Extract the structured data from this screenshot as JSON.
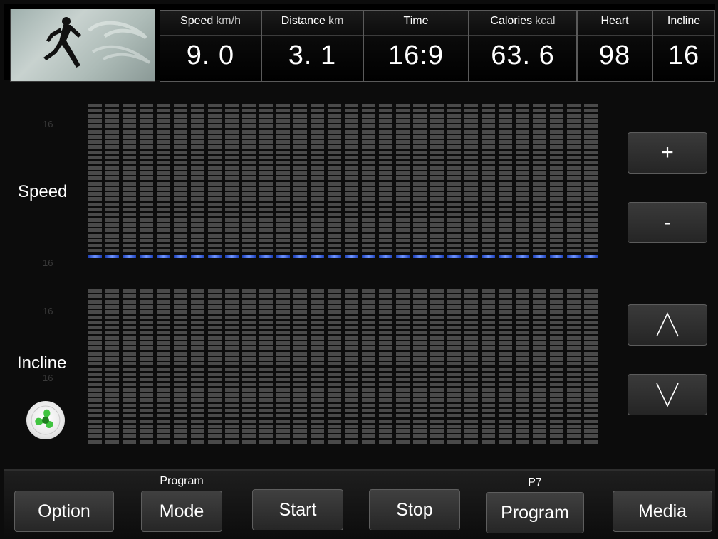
{
  "header": {
    "stats": [
      {
        "label": "Speed",
        "unit": "km/h",
        "value": "9. 0"
      },
      {
        "label": "Distance",
        "unit": "km",
        "value": "3. 1"
      },
      {
        "label": "Time",
        "unit": "",
        "value": "16:9"
      },
      {
        "label": "Calories",
        "unit": "kcal",
        "value": "63. 6"
      },
      {
        "label": "Heart",
        "unit": "",
        "value": "98"
      },
      {
        "label": "Incline",
        "unit": "",
        "value": "16"
      }
    ]
  },
  "main": {
    "speed_label": "Speed",
    "incline_label": "Incline",
    "speed_ghost_top": "16",
    "speed_ghost_bottom": "16",
    "incline_ghost_top": "16",
    "incline_ghost_bottom": "16",
    "plus_label": "+",
    "minus_label": "-",
    "speed_profile_segments_lit": 1,
    "incline_profile_segments_lit": 0,
    "lit_color": "#3f66e8"
  },
  "footer": {
    "option": "Option",
    "mode_caption": "Program",
    "mode": "Mode",
    "start": "Start",
    "stop": "Stop",
    "program_caption": "P7",
    "program": "Program",
    "media": "Media"
  }
}
